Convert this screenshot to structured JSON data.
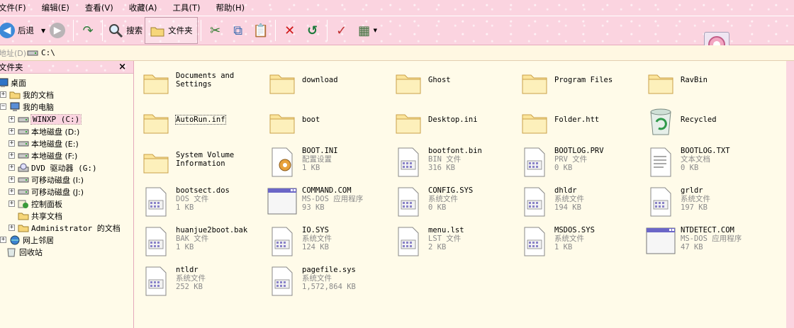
{
  "menu": [
    "文件(F)",
    "编辑(E)",
    "查看(V)",
    "收藏(A)",
    "工具(T)",
    "帮助(H)"
  ],
  "toolbar": {
    "back_label": "后退",
    "search_label": "搜索",
    "folders_label": "文件夹"
  },
  "address": {
    "label": "地址(D)",
    "value": "C:\\"
  },
  "folder_pane": {
    "title": "文件夹",
    "close": "×",
    "tree": [
      {
        "label": "桌面",
        "icon": "desktop-icon"
      },
      {
        "label": "我的文档",
        "icon": "folder-icon"
      },
      {
        "label": "我的电脑",
        "icon": "computer-icon"
      },
      {
        "label": "WINXP (C:)",
        "icon": "drive-icon"
      },
      {
        "label": "本地磁盘 (D:)",
        "icon": "drive-icon"
      },
      {
        "label": "本地磁盘 (E:)",
        "icon": "drive-icon"
      },
      {
        "label": "本地磁盘 (F:)",
        "icon": "drive-icon"
      },
      {
        "label": "DVD 驱动器 (G:)",
        "icon": "dvd-icon"
      },
      {
        "label": "可移动磁盘 (I:)",
        "icon": "drive-icon"
      },
      {
        "label": "可移动磁盘 (J:)",
        "icon": "drive-icon"
      },
      {
        "label": "控制面板",
        "icon": "control-panel-icon"
      },
      {
        "label": "共享文档",
        "icon": "folder-icon"
      },
      {
        "label": "Administrator 的文档",
        "icon": "folder-icon"
      },
      {
        "label": "网上邻居",
        "icon": "network-icon"
      },
      {
        "label": "回收站",
        "icon": "recycle-bin-icon"
      }
    ]
  },
  "files": [
    {
      "name1": "Documents and",
      "name2": "Settings",
      "kind": "folder"
    },
    {
      "name1": "download",
      "kind": "folder"
    },
    {
      "name1": "Ghost",
      "kind": "folder"
    },
    {
      "name1": "Program Files",
      "kind": "folder"
    },
    {
      "name1": "RavBin",
      "kind": "folder"
    },
    {
      "name1": "AutoRun.inf",
      "kind": "folder"
    },
    {
      "name1": "boot",
      "kind": "folder"
    },
    {
      "name1": "Desktop.ini",
      "kind": "folder"
    },
    {
      "name1": "Folder.htt",
      "kind": "folder"
    },
    {
      "name1": "Recycled",
      "kind": "recycle"
    },
    {
      "name1": "System Volume",
      "name2": "Information",
      "kind": "folder"
    },
    {
      "name": "BOOT.INI",
      "type": "配置设置",
      "size": "1 KB",
      "kind": "config"
    },
    {
      "name": "bootfont.bin",
      "type": "BIN 文件",
      "size": "316 KB",
      "kind": "sysfile"
    },
    {
      "name": "BOOTLOG.PRV",
      "type": "PRV 文件",
      "size": "0 KB",
      "kind": "sysfile"
    },
    {
      "name": "BOOTLOG.TXT",
      "type": "文本文档",
      "size": "0 KB",
      "kind": "text"
    },
    {
      "name": "bootsect.dos",
      "type": "DOS 文件",
      "size": "1 KB",
      "kind": "sysfile"
    },
    {
      "name": "COMMAND.COM",
      "type": "MS-DOS 应用程序",
      "size": "93 KB",
      "kind": "msdos"
    },
    {
      "name": "CONFIG.SYS",
      "type": "系统文件",
      "size": "0 KB",
      "kind": "sysfile"
    },
    {
      "name": "dhldr",
      "type": "系统文件",
      "size": "194 KB",
      "kind": "sysfile"
    },
    {
      "name": "grldr",
      "type": "系统文件",
      "size": "197 KB",
      "kind": "sysfile"
    },
    {
      "name": "huanjue2boot.bak",
      "type": "BAK 文件",
      "size": "1 KB",
      "kind": "sysfile"
    },
    {
      "name": "IO.SYS",
      "type": "系统文件",
      "size": "124 KB",
      "kind": "sysfile"
    },
    {
      "name": "menu.lst",
      "type": "LST 文件",
      "size": "2 KB",
      "kind": "sysfile"
    },
    {
      "name": "MSDOS.SYS",
      "type": "系统文件",
      "size": "1 KB",
      "kind": "sysfile"
    },
    {
      "name": "NTDETECT.COM",
      "type": "MS-DOS 应用程序",
      "size": "47 KB",
      "kind": "msdos"
    },
    {
      "name": "ntldr",
      "type": "系统文件",
      "size": "252 KB",
      "kind": "sysfile"
    },
    {
      "name": "pagefile.sys",
      "type": "系统文件",
      "size": "1,572,864 KB",
      "kind": "sysfile"
    }
  ]
}
